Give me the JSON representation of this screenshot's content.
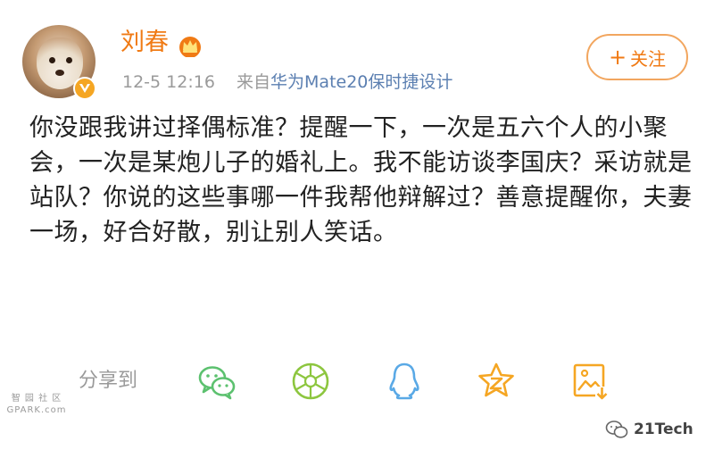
{
  "post": {
    "username": "刘春",
    "timestamp": "12-5 12:16",
    "source_prefix": "来自",
    "source_device": "华为Mate20保时捷设计",
    "follow_label": "关注",
    "text": "你没跟我讲过择偶标准？提醒一下，一次是五六个人的小聚会，一次是某炮儿子的婚礼上。我不能访谈李国庆？采访就是站队？你说的这些事哪一件我帮他辩解过？善意提醒你，夫妻一场，好合好散，别让别人笑话。"
  },
  "share": {
    "label": "分享到",
    "targets": [
      "wechat-icon",
      "moments-icon",
      "qq-icon",
      "qzone-icon",
      "save-image-icon"
    ]
  },
  "watermarks": {
    "left_line1": "智 园 社 区",
    "left_line2": "GPARK.com",
    "right": "21Tech"
  },
  "colors": {
    "username": "#f07a14",
    "device_link": "#5b7fb1",
    "icon_green": "#5cc16f",
    "icon_blue": "#5aa9e6",
    "icon_orange": "#f5a623"
  }
}
